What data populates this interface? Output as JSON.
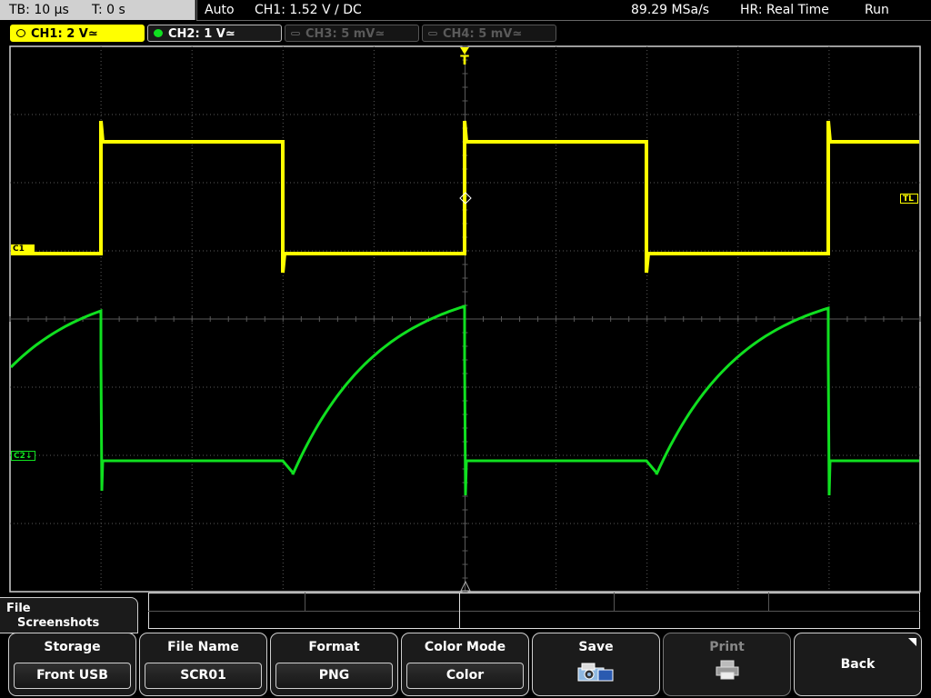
{
  "topbar": {
    "timebase": "TB: 10 µs",
    "trigger_time": "T: 0 s",
    "mode": "Auto",
    "trigger_info": "CH1: 1.52 V ∕ DC",
    "sample_rate": "89.29 MSa/s",
    "acquisition": "HR: Real Time",
    "run_state": "Run"
  },
  "channels": [
    {
      "label": "CH1: 2 V≃",
      "color": "#ffff00",
      "active": true
    },
    {
      "label": "CH2: 1 V≃",
      "color": "#10e020",
      "active": true
    },
    {
      "label": "CH3: 5 mV≃",
      "color": "#5a5a5a",
      "active": false
    },
    {
      "label": "CH4: 5 mV≃",
      "color": "#5a5a5a",
      "active": false
    }
  ],
  "markers": {
    "ch1_ref": "C1",
    "ch2_ref": "C2↓",
    "trigger_level": "TL",
    "trigger_pos": "T"
  },
  "menu": {
    "title_line1": "File",
    "title_line2": "Screenshots"
  },
  "softkeys": [
    {
      "head": "Storage",
      "value": "Front USB"
    },
    {
      "head": "File Name",
      "value": "SCR01"
    },
    {
      "head": "Format",
      "value": "PNG"
    },
    {
      "head": "Color Mode",
      "value": "Color"
    },
    {
      "head": "Save",
      "icon": "camera-save-icon"
    },
    {
      "head": "Print",
      "icon": "printer-icon",
      "disabled": true
    },
    {
      "head": "Back"
    }
  ],
  "colors": {
    "ch1": "#ffff00",
    "ch2": "#10e020",
    "grid": "#5a5a5a"
  }
}
